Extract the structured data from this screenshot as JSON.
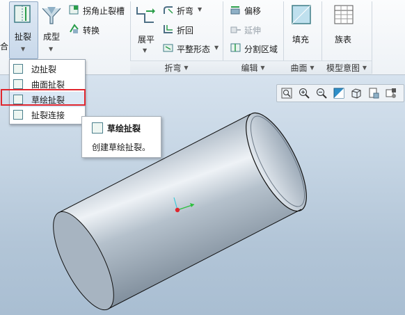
{
  "ribbon": {
    "buttons": {
      "rip": "扯裂",
      "form": "成型",
      "corner_relief": "拐角止裂槽",
      "convert": "转换",
      "unbend": "展平",
      "bend": "折弯",
      "bend_back": "折回",
      "flat_state": "平整形态",
      "offset": "偏移",
      "extend": "延伸",
      "split_area": "分割区域",
      "fill": "填充",
      "family_table": "族表"
    },
    "groups": {
      "bends": "折弯",
      "editing": "编辑",
      "surfaces": "曲面",
      "model_intent": "模型意图"
    },
    "cut_off_left": "合"
  },
  "rip_menu": {
    "items": [
      "边扯裂",
      "曲面扯裂",
      "草绘扯裂",
      "扯裂连接"
    ],
    "selected": "草绘扯裂"
  },
  "tooltip": {
    "title": "草绘扯裂",
    "description": "创建草绘扯裂。"
  },
  "view_toolbar": {
    "icons": [
      "zoom-fit-icon",
      "zoom-in-icon",
      "zoom-out-icon",
      "repaint-icon",
      "display-style-icon",
      "saved-views-icon",
      "datum-display-icon"
    ]
  },
  "colors": {
    "highlight_border": "#e0262e",
    "cylinder_light": "#dfe6ee",
    "cylinder_dark": "#7b8a99"
  }
}
